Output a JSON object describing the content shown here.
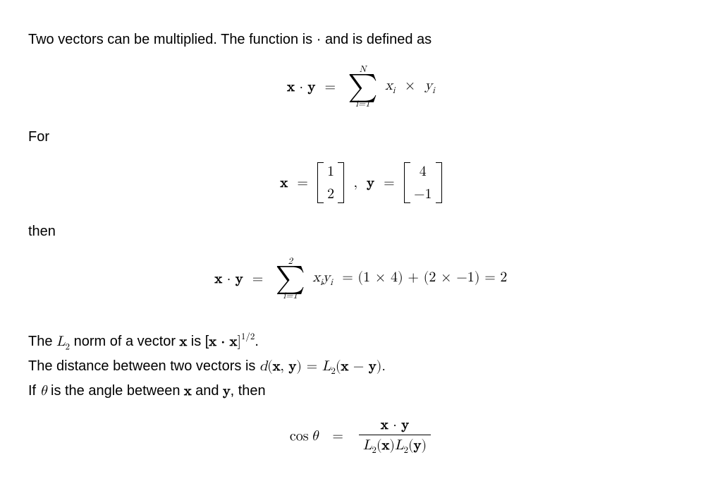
{
  "intro": "Two vectors can be multiplied. The function is · and is defined as",
  "eq1": {
    "lhs_x": "x",
    "dot": "·",
    "lhs_y": "y",
    "eq": "=",
    "sum_top": "N",
    "sum_sym": "∑",
    "sum_bot": "i=1",
    "term_xi": "x",
    "term_i": "i",
    "times": "×",
    "term_yi": "y"
  },
  "for": "For",
  "eq2": {
    "x_lbl": "x",
    "eq": "=",
    "x1": "1",
    "x2": "2",
    "comma": ",",
    "y_lbl": "y",
    "y1": "4",
    "y2": "−1"
  },
  "then": "then",
  "eq3": {
    "lhs_x": "x",
    "dot": "·",
    "lhs_y": "y",
    "eq": "=",
    "sum_top": "2",
    "sum_sym": "∑",
    "sum_bot": "i=1",
    "sumterm": "xᵢyᵢ",
    "expand": "= (1 × 4) + (2 × −1) = 2"
  },
  "p2_line1_pre": "The ",
  "p2_line1_L2": "L",
  "p2_line1_L2sub": "2",
  "p2_line1_mid": " norm of a vector ",
  "p2_line1_x": "x",
  "p2_line1_is": " is [",
  "p2_line1_xx": "x · x",
  "p2_line1_close": "]",
  "p2_line1_exp": "1/2",
  "p2_line1_dot": ".",
  "p2_line2_pre": "The distance between two vectors is ",
  "p2_line2_d": "d",
  "p2_line2_args": "(x, y) = L",
  "p2_line2_sub": "2",
  "p2_line2_tail": "(x − y).",
  "p2_line3_pre": "If ",
  "p2_line3_theta": "θ",
  "p2_line3_mid": " is the angle between ",
  "p2_line3_x": "x",
  "p2_line3_and": " and ",
  "p2_line3_y": "y",
  "p2_line3_end": ", then",
  "eq4": {
    "cos": "cos",
    "theta": "θ",
    "eq": "=",
    "num_x": "x",
    "dot": "·",
    "num_y": "y",
    "den_L": "L",
    "den_sub": "2",
    "den_x": "(x)",
    "den_y": "(y)"
  },
  "chart_data": {
    "type": "table",
    "title": "Dot product worked example",
    "vectors": {
      "x": [
        1,
        2
      ],
      "y": [
        4,
        -1
      ]
    },
    "dot_product_terms": [
      [
        1,
        4
      ],
      [
        2,
        -1
      ]
    ],
    "dot_product_result": 2,
    "formulas": {
      "dot_product": "x·y = Σ_{i=1}^{N} x_i × y_i",
      "L2_norm": "[x·x]^{1/2}",
      "distance": "d(x,y) = L2(x − y)",
      "cosine": "cos θ = (x·y) / (L2(x) L2(y))"
    }
  }
}
